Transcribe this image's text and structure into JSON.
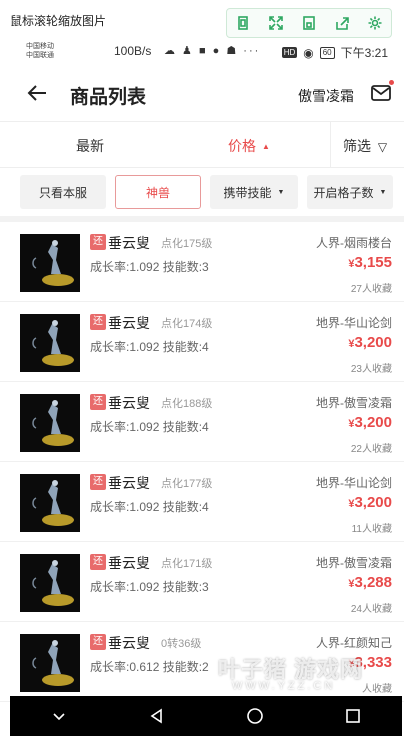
{
  "viewer": {
    "title": "鼠标滚轮缩放图片",
    "tools": [
      "fit-icon",
      "fullscreen-icon",
      "save-icon",
      "share-icon",
      "settings-icon"
    ]
  },
  "status": {
    "carrier1": "中国移动",
    "carrier2": "中国联通",
    "network_speed": "100B/s",
    "battery": "60",
    "time": "下午3:21"
  },
  "header": {
    "title": "商品列表",
    "server": "傲雪凌霜"
  },
  "sort": {
    "newest": "最新",
    "price": "价格",
    "filter": "筛选"
  },
  "chips": {
    "own_server": "只看本服",
    "beast": "神兽",
    "skills": "携带技能",
    "slots": "开启格子数"
  },
  "colors": {
    "accent": "#e84a4a",
    "tag": "#e86b6b"
  },
  "items": [
    {
      "tag": "还",
      "name": "垂云叟",
      "level": "点化175级",
      "stats": "成长率:1.092 技能数:3",
      "server": "人界-烟雨楼台",
      "currency": "¥",
      "price": "3,155",
      "favs": "27人收藏"
    },
    {
      "tag": "还",
      "name": "垂云叟",
      "level": "点化174级",
      "stats": "成长率:1.092 技能数:4",
      "server": "地界-华山论剑",
      "currency": "¥",
      "price": "3,200",
      "favs": "23人收藏"
    },
    {
      "tag": "还",
      "name": "垂云叟",
      "level": "点化188级",
      "stats": "成长率:1.092 技能数:4",
      "server": "地界-傲雪凌霜",
      "currency": "¥",
      "price": "3,200",
      "favs": "22人收藏"
    },
    {
      "tag": "还",
      "name": "垂云叟",
      "level": "点化177级",
      "stats": "成长率:1.092 技能数:4",
      "server": "地界-华山论剑",
      "currency": "¥",
      "price": "3,200",
      "favs": "11人收藏"
    },
    {
      "tag": "还",
      "name": "垂云叟",
      "level": "点化171级",
      "stats": "成长率:1.092 技能数:3",
      "server": "地界-傲雪凌霜",
      "currency": "¥",
      "price": "3,288",
      "favs": "24人收藏"
    },
    {
      "tag": "还",
      "name": "垂云叟",
      "level": "0转36级",
      "stats": "成长率:0.612 技能数:2",
      "server": "人界-红颜知己",
      "currency": "¥",
      "price": "3,333",
      "favs": "人收藏"
    }
  ],
  "watermark": {
    "main": "叶子猪 游戏网",
    "sub": "WWW.YZZ.CN"
  }
}
